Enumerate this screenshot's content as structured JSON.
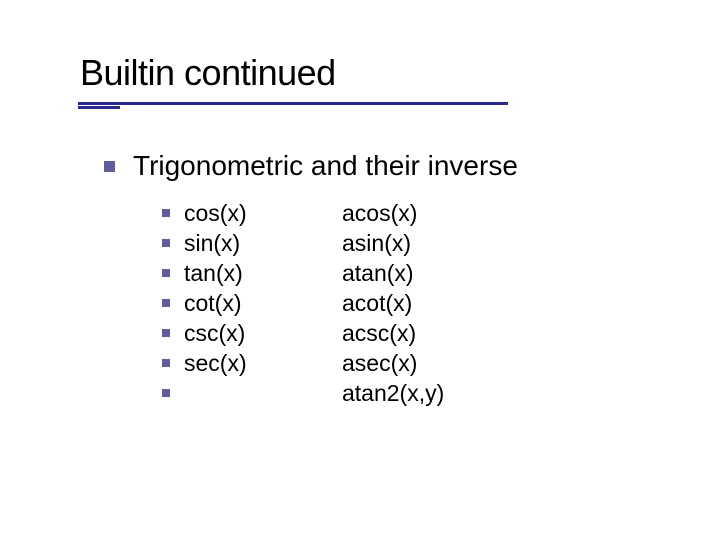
{
  "title": "Builtin continued",
  "heading": "Trigonometric  and their inverse",
  "rows": [
    {
      "a": "cos(x)",
      "b": "acos(x)"
    },
    {
      "a": "sin(x)",
      "b": "asin(x)"
    },
    {
      "a": "tan(x)",
      "b": "atan(x)"
    },
    {
      "a": "cot(x)",
      "b": "acot(x)"
    },
    {
      "a": "csc(x)",
      "b": "acsc(x)"
    },
    {
      "a": "sec(x)",
      "b": "asec(x)"
    },
    {
      "a": "",
      "b": "atan2(x,y)"
    }
  ]
}
